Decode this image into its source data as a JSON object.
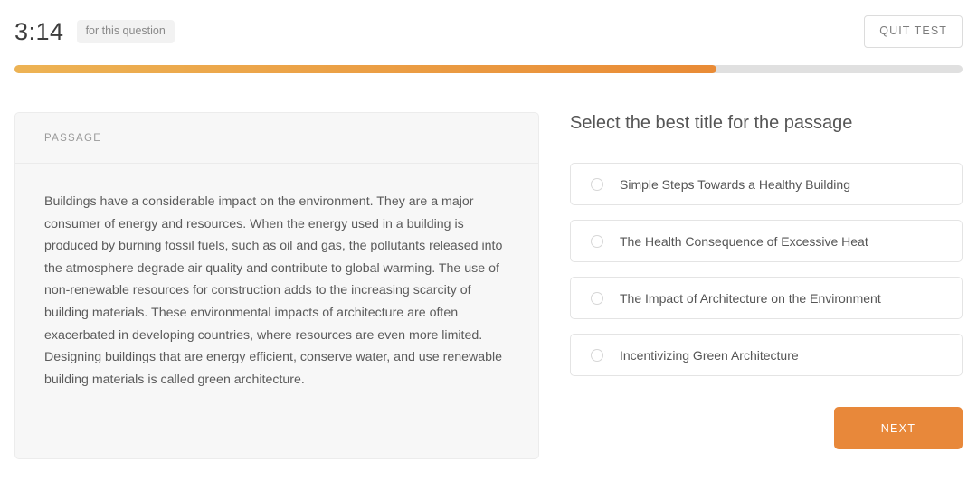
{
  "header": {
    "timer": "3:14",
    "timer_caption": "for this question",
    "quit_label": "QUIT TEST"
  },
  "progress": {
    "percent": 74,
    "fill_start_color": "#edb354",
    "fill_end_color": "#e98b36",
    "track_color": "#e0e0e0"
  },
  "passage": {
    "label": "PASSAGE",
    "text": "Buildings have a considerable impact on the environment. They are a major consumer of energy and resources. When the energy used in a building is produced by burning fossil fuels, such as oil and gas, the pollutants released into the atmosphere degrade air quality and contribute to global warming. The use of non-renewable resources for construction adds to the increasing scarcity of building materials. These environmental impacts of architecture are often exacerbated in developing countries, where resources are even more limited. Designing buildings that are energy efficient, conserve water, and use renewable building materials is called green architecture."
  },
  "question": {
    "title": "Select the best title for the passage",
    "options": [
      {
        "label": "Simple Steps Towards a Healthy Building",
        "selected": false
      },
      {
        "label": "The Health Consequence of Excessive Heat",
        "selected": false
      },
      {
        "label": "The Impact of Architecture on the Environment",
        "selected": false
      },
      {
        "label": "Incentivizing Green Architecture",
        "selected": false
      }
    ],
    "next_label": "NEXT",
    "next_color": "#e8883a"
  }
}
